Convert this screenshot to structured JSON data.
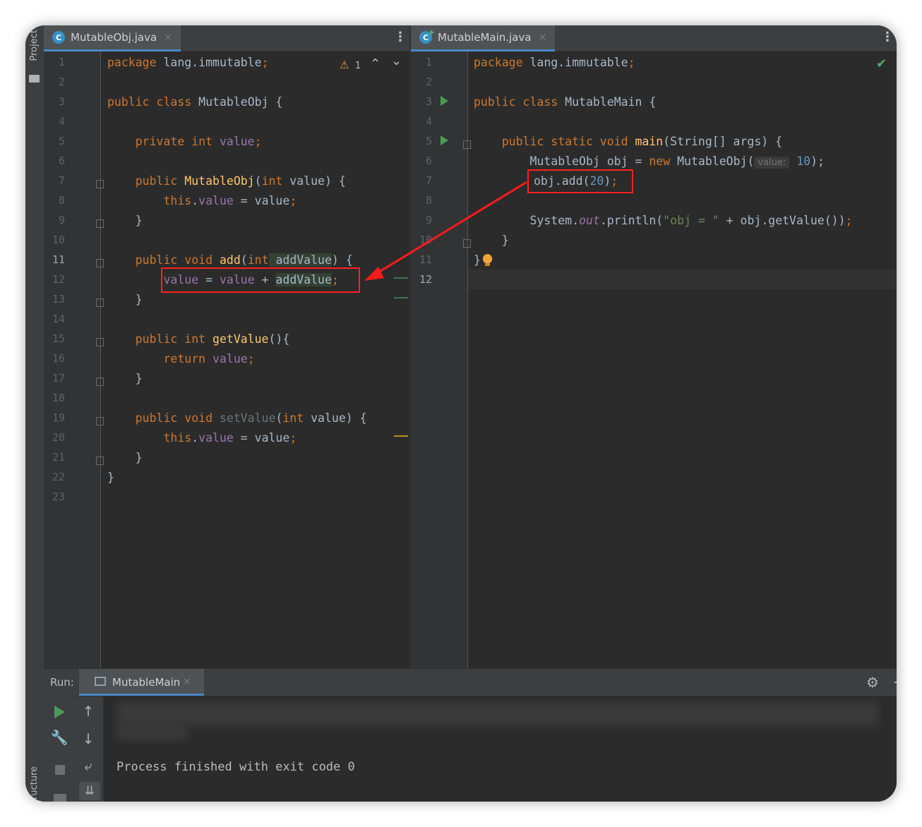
{
  "sidebar": {
    "project_label": "Project",
    "structure_label": "ructure"
  },
  "left_editor": {
    "tab": {
      "icon": "C",
      "name": "MutableObj.java",
      "close": "×"
    },
    "warning": {
      "icon": "⚠",
      "count": "1"
    },
    "nav_up": "⌃",
    "nav_down": "⌄",
    "line_numbers": [
      "1",
      "2",
      "3",
      "4",
      "5",
      "6",
      "7",
      "8",
      "9",
      "10",
      "11",
      "12",
      "13",
      "14",
      "15",
      "16",
      "17",
      "18",
      "19",
      "20",
      "21",
      "22",
      "23"
    ],
    "current_line": "11",
    "lines": {
      "l1a": "package",
      "l1b": " lang.immutable",
      "l1c": ";",
      "l3a": "public class",
      "l3b": " MutableObj {",
      "l5a": "    private int",
      "l5b": " value",
      "l5c": ";",
      "l7a": "    public",
      "l7b": " MutableObj",
      "l7c": "(",
      "l7d": "int",
      "l7e": " value) {",
      "l8a": "        this",
      "l8b": ".",
      "l8c": "value",
      "l8d": " = value",
      "l8e": ";",
      "l9": "    }",
      "l11a": "    public void",
      "l11b": " add",
      "l11c": "(",
      "l11d": "int",
      "l11e": " addValue",
      "l11f": ") {",
      "l12a": "        ",
      "l12b": "value",
      "l12c": " = ",
      "l12d": "value",
      "l12e": " + ",
      "l12f": "addValue",
      "l12g": ";",
      "l13": "    }",
      "l15a": "    public int",
      "l15b": " getValue",
      "l15c": "(){",
      "l16a": "        return",
      "l16b": " value",
      "l16c": ";",
      "l17": "    }",
      "l19a": "    public void",
      "l19b": " setValue",
      "l19c": "(",
      "l19d": "int",
      "l19e": " value) {",
      "l20a": "        this",
      "l20b": ".",
      "l20c": "value",
      "l20d": " = value",
      "l20e": ";",
      "l21": "    }",
      "l22": "}"
    }
  },
  "right_editor": {
    "tab": {
      "icon": "C",
      "name": "MutableMain.java",
      "close": "×"
    },
    "check": "✔",
    "line_numbers": [
      "1",
      "2",
      "3",
      "4",
      "5",
      "6",
      "7",
      "8",
      "9",
      "10",
      "11",
      "12"
    ],
    "current_line": "12",
    "lines": {
      "l1a": "package",
      "l1b": " lang.immutable",
      "l1c": ";",
      "l3a": "public class",
      "l3b": " MutableMain {",
      "l5a": "    public static void",
      "l5b": " main",
      "l5c": "(String[] args) {",
      "l6a": "        MutableObj obj = ",
      "l6b": "new",
      "l6c": " MutableObj(",
      "l6hint": "value:",
      "l6d": " 10",
      "l6e": ");",
      "l7a": "obj.add(",
      "l7b": "20",
      "l7c": ")",
      "l7d": ";",
      "l9a": "        System.",
      "l9b": "out",
      "l9c": ".println(",
      "l9d": "\"obj = \"",
      "l9e": " + obj.getValue())",
      "l9f": ";",
      "l10": "    }",
      "l11": "}"
    }
  },
  "run_panel": {
    "label": "Run:",
    "tab_name": "MutableMain",
    "tab_close": "×",
    "output": "Process finished with exit code 0",
    "truncated_char": "g"
  },
  "colors": {
    "keyword": "#cc7832",
    "field": "#9876aa",
    "method": "#ffc66d",
    "number": "#6897bb",
    "string": "#6a8759",
    "annotation_box": "#ff2020"
  }
}
